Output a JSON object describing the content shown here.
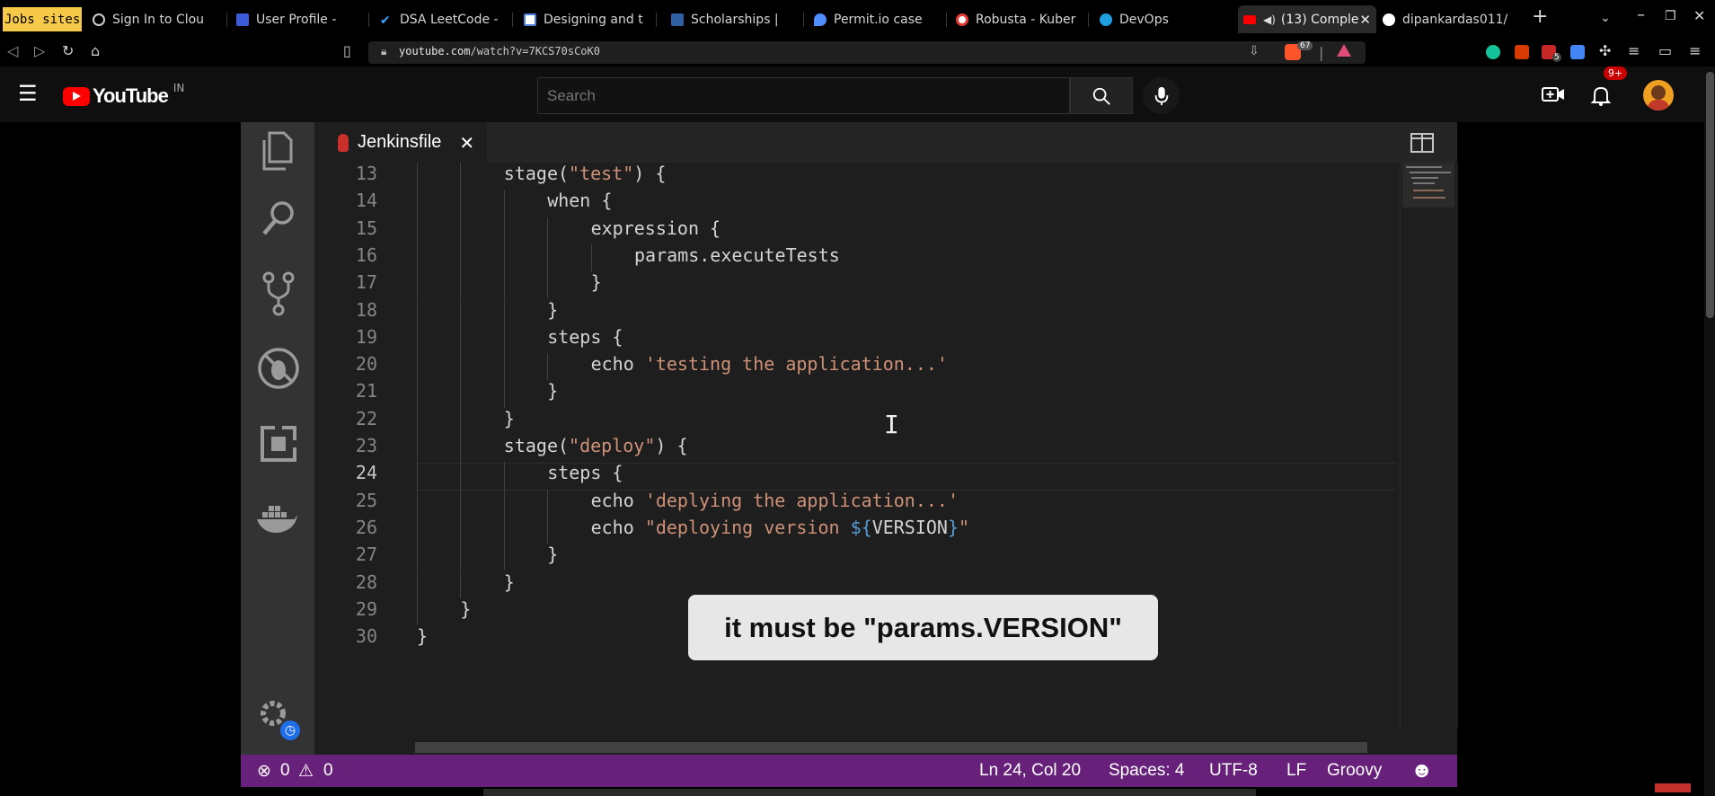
{
  "browser": {
    "tabs": [
      {
        "label": "Jobs sites",
        "icon": "bookmark-folder-icon"
      },
      {
        "label": "Sign In to Clou",
        "icon": "globe-icon"
      },
      {
        "label": "User Profile -",
        "icon": "profile-icon"
      },
      {
        "label": "DSA LeetCode -",
        "icon": "check-icon"
      },
      {
        "label": "Designing and t",
        "icon": "diamond-icon"
      },
      {
        "label": "Scholarships |",
        "icon": "grid-icon"
      },
      {
        "label": "Permit.io case",
        "icon": "drop-icon"
      },
      {
        "label": "Robusta - Kuber",
        "icon": "helm-icon"
      },
      {
        "label": "DevOps",
        "icon": "cloud-icon"
      },
      {
        "label": "(13) Comple",
        "icon": "youtube-icon",
        "active": true
      },
      {
        "label": "dipankardas011/",
        "icon": "github-icon"
      }
    ],
    "url": {
      "domain": "youtube.com",
      "path": "/watch?v=7KCS70sCoK0"
    },
    "brave_count": "67",
    "ext_badge": "5"
  },
  "youtube": {
    "logo_text": "YouTube",
    "country": "IN",
    "search_placeholder": "Search",
    "notifications": "9+"
  },
  "editor": {
    "tab_title": "Jenkinsfile",
    "lines": [
      {
        "n": "13",
        "indent": 2,
        "parts": [
          [
            "t",
            "stage("
          ],
          [
            "s",
            "\"test\""
          ],
          [
            "t",
            ") {"
          ]
        ]
      },
      {
        "n": "14",
        "indent": 3,
        "parts": [
          [
            "t",
            "when {"
          ]
        ]
      },
      {
        "n": "15",
        "indent": 4,
        "parts": [
          [
            "t",
            "expression {"
          ]
        ]
      },
      {
        "n": "16",
        "indent": 5,
        "parts": [
          [
            "t",
            "params.executeTests"
          ]
        ]
      },
      {
        "n": "17",
        "indent": 4,
        "parts": [
          [
            "t",
            "}"
          ]
        ]
      },
      {
        "n": "18",
        "indent": 3,
        "parts": [
          [
            "t",
            "}"
          ]
        ]
      },
      {
        "n": "19",
        "indent": 3,
        "parts": [
          [
            "t",
            "steps {"
          ]
        ]
      },
      {
        "n": "20",
        "indent": 4,
        "parts": [
          [
            "t",
            "echo "
          ],
          [
            "s",
            "'testing the application...'"
          ]
        ]
      },
      {
        "n": "21",
        "indent": 3,
        "parts": [
          [
            "t",
            "}"
          ]
        ]
      },
      {
        "n": "22",
        "indent": 2,
        "parts": [
          [
            "t",
            "}"
          ]
        ]
      },
      {
        "n": "23",
        "indent": 2,
        "parts": [
          [
            "t",
            "stage("
          ],
          [
            "s",
            "\"deploy\""
          ],
          [
            "t",
            ") {"
          ]
        ]
      },
      {
        "n": "24",
        "indent": 3,
        "parts": [
          [
            "t",
            "steps {"
          ]
        ]
      },
      {
        "n": "25",
        "indent": 4,
        "parts": [
          [
            "t",
            "echo "
          ],
          [
            "s",
            "'deplying the application...'"
          ]
        ]
      },
      {
        "n": "26",
        "indent": 4,
        "parts": [
          [
            "t",
            "echo "
          ],
          [
            "s",
            "\"deploying version "
          ],
          [
            "v",
            "${"
          ],
          [
            "t",
            "VERSION"
          ],
          [
            "v",
            "}"
          ],
          [
            "s",
            "\""
          ]
        ]
      },
      {
        "n": "27",
        "indent": 3,
        "parts": [
          [
            "t",
            "}"
          ]
        ]
      },
      {
        "n": "28",
        "indent": 2,
        "parts": [
          [
            "t",
            "}"
          ]
        ]
      },
      {
        "n": "29",
        "indent": 1,
        "parts": [
          [
            "t",
            "}"
          ]
        ]
      },
      {
        "n": "30",
        "indent": 0,
        "parts": [
          [
            "t",
            "}"
          ]
        ]
      }
    ],
    "current_line": "24",
    "status": {
      "errors": "0",
      "warnings": "0",
      "position": "Ln 24, Col 20",
      "spaces": "Spaces: 4",
      "encoding": "UTF-8",
      "eol": "LF",
      "language": "Groovy"
    }
  },
  "caption": "it must be \"params.VERSION\"",
  "colors": {
    "statusbar": "#68217a",
    "string": "#ce9178",
    "variable": "#569cd6",
    "youtube_red": "#ff0000"
  }
}
